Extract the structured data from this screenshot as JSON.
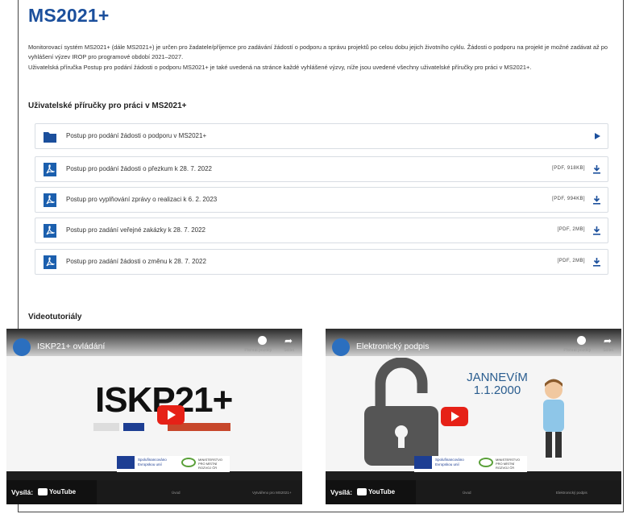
{
  "header": {
    "title": "MS2021+"
  },
  "intro": {
    "p1": "Monitorovací systém MS2021+ (dále MS2021+) je určen pro žadatele/příjemce pro zadávání žádostí o podporu a správu projektů po celou dobu jejich životního cyklu. Žádosti o podporu na projekt je možné zadávat až po vyhlášení výzev IROP pro programové období 2021–2027.",
    "p2": "Uživatelská příručka Postup pro podání žádosti o podporu  MS2021+ je také uvedená na stránce každé vyhlášené výzvy, níže jsou uvedené všechny uživatelské příručky pro práci v MS2021+."
  },
  "manuals": {
    "heading": "Uživatelské příručky pro práci v MS2021+",
    "items": [
      {
        "label": "Postup pro podání žádosti o podporu v MS2021+",
        "meta": "",
        "kind": "folder"
      },
      {
        "label": "Postup pro podání žádosti o přezkum k 28. 7. 2022",
        "meta": "[PDF, 918KB]",
        "kind": "pdf"
      },
      {
        "label": "Postup pro vyplňování zprávy o realizaci k 6. 2. 2023",
        "meta": "[PDF, 994KB]",
        "kind": "pdf"
      },
      {
        "label": "Postup pro zadání veřejné zakázky k 28. 7. 2022",
        "meta": "[PDF, 2MB]",
        "kind": "pdf"
      },
      {
        "label": "Postup pro zadání žádosti o změnu k 28. 7. 2022",
        "meta": "[PDF, 2MB]",
        "kind": "pdf"
      }
    ]
  },
  "videos": {
    "heading": "Videotutoriály",
    "items": [
      {
        "title": "ISKP21+ ovládání",
        "hero": "ISKP21+",
        "watch_later": "Přehrát později",
        "share": "Sdílet",
        "footer_mid": "Úvod",
        "footer_right": "Vytvářeno pro MS2021+",
        "played_by": "Vysílá:",
        "brand": "YouTube"
      },
      {
        "title": "Elektronický podpis",
        "hero": "JANNEVíM\n1.1.2000",
        "watch_later": "Přehrát později",
        "share": "Sdílet",
        "footer_mid": "Úvod",
        "footer_right": "Elektronický podpis",
        "played_by": "Vysílá:",
        "brand": "YouTube"
      }
    ],
    "logos": {
      "eu_line1": "Spolufinancováno",
      "eu_line2": "Evropskou unií",
      "mmr_line1": "MINISTERSTVO",
      "mmr_line2": "PRO MÍSTNÍ",
      "mmr_line3": "ROZVOJ ČR"
    }
  },
  "colors": {
    "brand": "#1b4f9c",
    "pdf": "#1b5fae",
    "youtube_red": "#e62117"
  }
}
